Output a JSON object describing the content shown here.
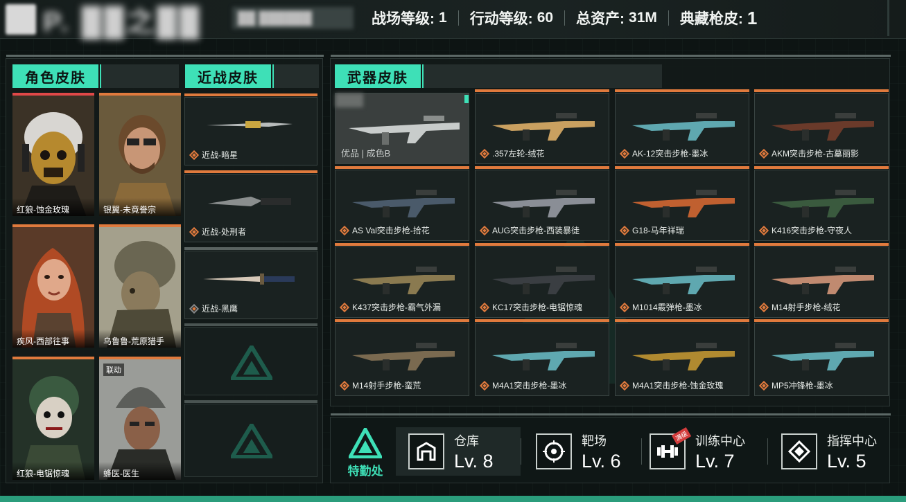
{
  "header": {
    "player_name": "P. ██之██",
    "player_id": "██ ██████",
    "stats": [
      {
        "label": "战场等级:",
        "value": "1"
      },
      {
        "label": "行动等级:",
        "value": " 60"
      },
      {
        "label": "总资产:",
        "value": "31M"
      },
      {
        "label": "典藏枪皮:",
        "value": "1"
      }
    ]
  },
  "character_skins": {
    "title": "角色皮肤",
    "items": [
      {
        "name": "红狼-蚀金玫瑰",
        "tag": ""
      },
      {
        "name": "银翼-未竟誊宗",
        "tag": ""
      },
      {
        "name": "疾风-西部往事",
        "tag": ""
      },
      {
        "name": "乌鲁鲁-荒原猎手",
        "tag": ""
      },
      {
        "name": "红狼-电锯惊魂",
        "tag": ""
      },
      {
        "name": "蜂医-医生",
        "tag": "联动"
      }
    ]
  },
  "melee_skins": {
    "title": "近战皮肤",
    "items": [
      {
        "name": "近战-暗星"
      },
      {
        "name": "近战-处刑者"
      },
      {
        "name": "近战-黑鹰"
      }
    ]
  },
  "weapon_skins": {
    "title": "武器皮肤",
    "featured": {
      "quality": "优品 | 成色B"
    },
    "items": [
      {
        "name": ".357左轮-绒花"
      },
      {
        "name": "AK-12突击步枪-墨冰"
      },
      {
        "name": "AKM突击步枪-古墓丽影"
      },
      {
        "name": "AS Val突击步枪-拾花"
      },
      {
        "name": "AUG突击步枪-西装暴徒"
      },
      {
        "name": "G18-马年祥瑞"
      },
      {
        "name": "K416突击步枪-守夜人"
      },
      {
        "name": "K437突击步枪-霸气外漏"
      },
      {
        "name": "KC17突击步枪-电锯惊魂"
      },
      {
        "name": "M1014霰弹枪-墨冰"
      },
      {
        "name": "M14射手步枪-绒花"
      },
      {
        "name": "M14射手步枪-蛮荒"
      },
      {
        "name": "M4A1突击步枪-墨冰"
      },
      {
        "name": "M4A1突击步枪-蚀金玫瑰"
      },
      {
        "name": "MP5冲锋枪-墨冰"
      }
    ]
  },
  "bottom": {
    "dept_label": "特勤处",
    "facilities": [
      {
        "name": "仓库",
        "level": "Lv. 8",
        "icon": "warehouse-icon",
        "badge": ""
      },
      {
        "name": "靶场",
        "level": "Lv. 6",
        "icon": "target-icon",
        "badge": ""
      },
      {
        "name": "训练中心",
        "level": "Lv. 7",
        "icon": "dumbbell-icon",
        "badge": "满级"
      },
      {
        "name": "指挥中心",
        "level": "Lv. 5",
        "icon": "command-icon",
        "badge": ""
      }
    ]
  },
  "colors": {
    "accent": "#3ee0b7",
    "orange": "#e07a3d",
    "red": "#e04848",
    "bg": "#0d1413"
  }
}
